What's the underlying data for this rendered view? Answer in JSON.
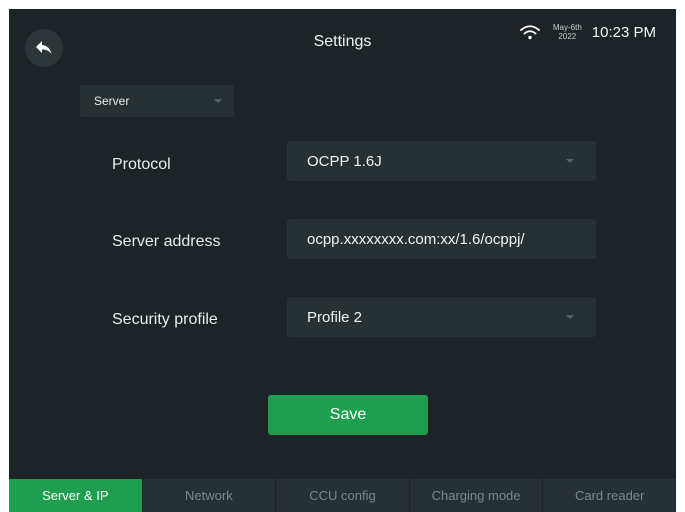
{
  "header": {
    "title": "Settings",
    "date_top": "May-6th",
    "date_bottom": "2022",
    "time": "10:23 PM",
    "back_icon": "back-arrow-icon",
    "wifi_icon": "wifi-icon"
  },
  "category": {
    "selected": "Server"
  },
  "form": {
    "protocol": {
      "label": "Protocol",
      "value": "OCPP 1.6J"
    },
    "server_address": {
      "label": "Server address",
      "value": "ocpp.xxxxxxxx.com:xx/1.6/ocppj/"
    },
    "security_profile": {
      "label": "Security profile",
      "value": "Profile 2"
    }
  },
  "save_label": "Save",
  "tabs": [
    {
      "label": "Server & IP",
      "active": true
    },
    {
      "label": "Network",
      "active": false
    },
    {
      "label": "CCU config",
      "active": false
    },
    {
      "label": "Charging mode",
      "active": false
    },
    {
      "label": "Card reader",
      "active": false
    }
  ],
  "colors": {
    "background": "#1c2427",
    "panel": "#273033",
    "accent": "#1f9e4f"
  }
}
